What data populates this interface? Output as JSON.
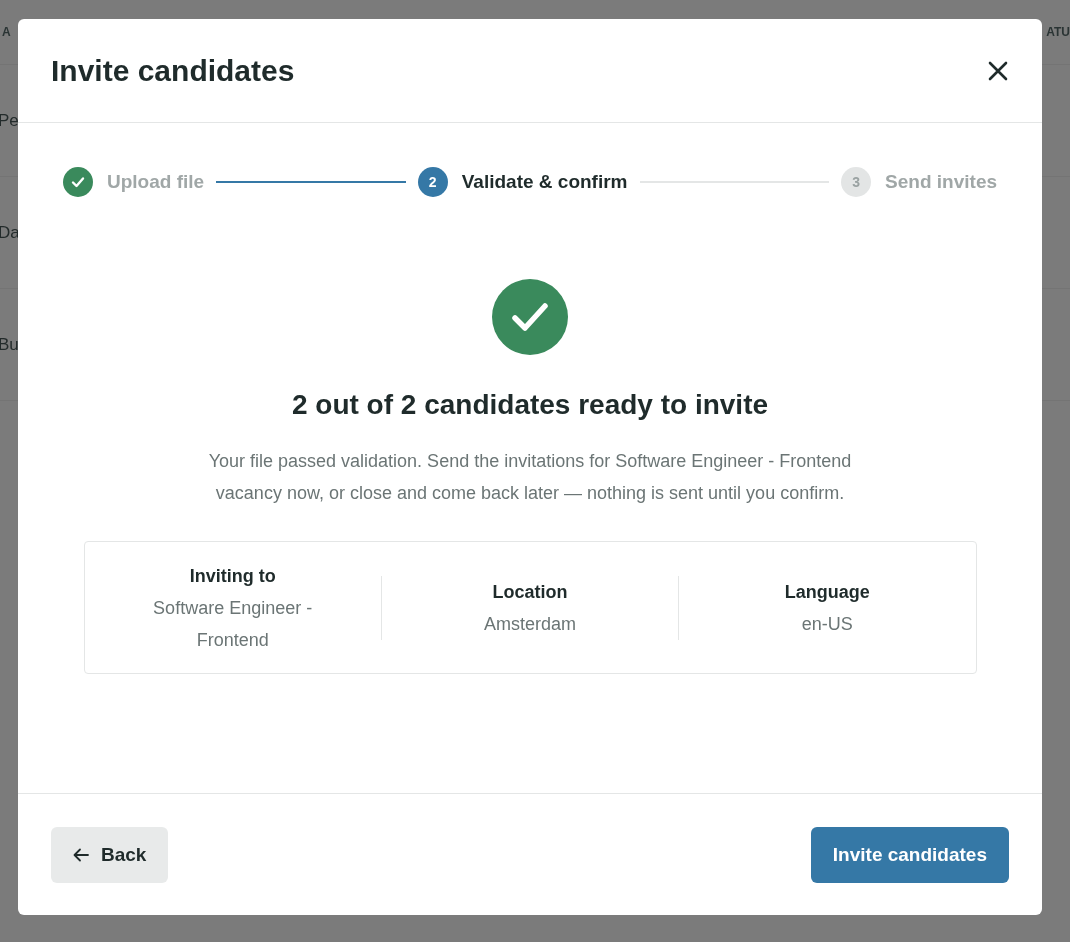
{
  "background": {
    "columns": [
      "A",
      "ATU"
    ],
    "rows": [
      "Pe",
      "Da",
      "Bu"
    ]
  },
  "dialog": {
    "title": "Invite candidates",
    "steps": [
      {
        "label": "Upload file",
        "completed": true,
        "selected": false
      },
      {
        "number": "2",
        "label": "Validate & confirm",
        "completed": false,
        "selected": true
      },
      {
        "number": "3",
        "label": "Send invites",
        "completed": false,
        "selected": false
      }
    ],
    "result": {
      "heading": "2 out of 2 candidates ready to invite",
      "message": "Your file passed validation. Send the invitations for Software Engineer - Frontend vacancy now, or close and come back later — nothing is sent until you confirm."
    },
    "details": [
      {
        "label": "Inviting to",
        "value": "Software Engineer - Frontend"
      },
      {
        "label": "Location",
        "value": "Amsterdam"
      },
      {
        "label": "Language",
        "value": "en-US"
      }
    ],
    "back_button": "Back",
    "primary_button": "Invite candidates"
  }
}
